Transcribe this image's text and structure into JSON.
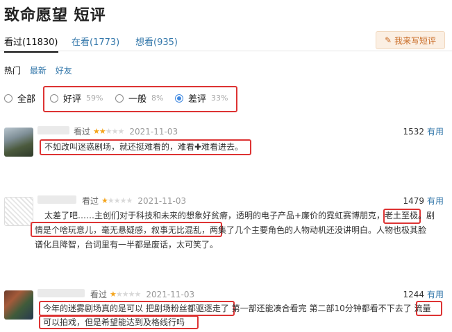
{
  "page": {
    "title": "致命愿望 短评"
  },
  "tabs": {
    "watched": "看过(11830)",
    "watching": "在看(1773)",
    "want": "想看(935)",
    "write_button": "我来写短评"
  },
  "subtabs": {
    "hot": "热门",
    "latest": "最新",
    "friends": "好友"
  },
  "filters": {
    "all": "全部",
    "good": "好评",
    "good_pct": "59%",
    "ok": "一般",
    "ok_pct": "8%",
    "bad": "差评",
    "bad_pct": "33%",
    "selected": "bad"
  },
  "reviews": [
    {
      "status": "看过",
      "rating": 2,
      "date": "2021-11-03",
      "votes": "1532",
      "useful": "有用",
      "lines": [
        "不如改叫迷惑剧场，就还挺难看的，难看✚难看进去。"
      ]
    },
    {
      "status": "看过",
      "rating": 1,
      "date": "2021-11-03",
      "votes": "1479",
      "useful": "有用",
      "lines": [
        "太差了吧……主创们对于科技和未来的想象好贫瘠，透明的电子产品+廉价的霓虹赛博朋克，老土至极。剧",
        "情是个啥玩意儿，毫无悬疑感，叙事无比混乱，两集了几个主要角色的人物动机还没讲明白。人物也极其脸",
        "谱化且降智，台词里有一半都是废话，太可笑了。"
      ]
    },
    {
      "status": "看过",
      "rating": 1,
      "date": "2021-11-03",
      "votes": "1244",
      "useful": "有用",
      "lines": [
        "今年的迷雾剧场真的是可以 把剧场粉丝都驱逐走了 第一部还能凑合看完 第二部10分钟都看不下去了 流量",
        "可以拍戏，但是希望能达到及格线行吗"
      ]
    }
  ],
  "colors": {
    "link": "#3377aa",
    "highlight_box": "#dd3333",
    "star": "#f4a41a",
    "write_button_bg": "#fbefe3"
  }
}
